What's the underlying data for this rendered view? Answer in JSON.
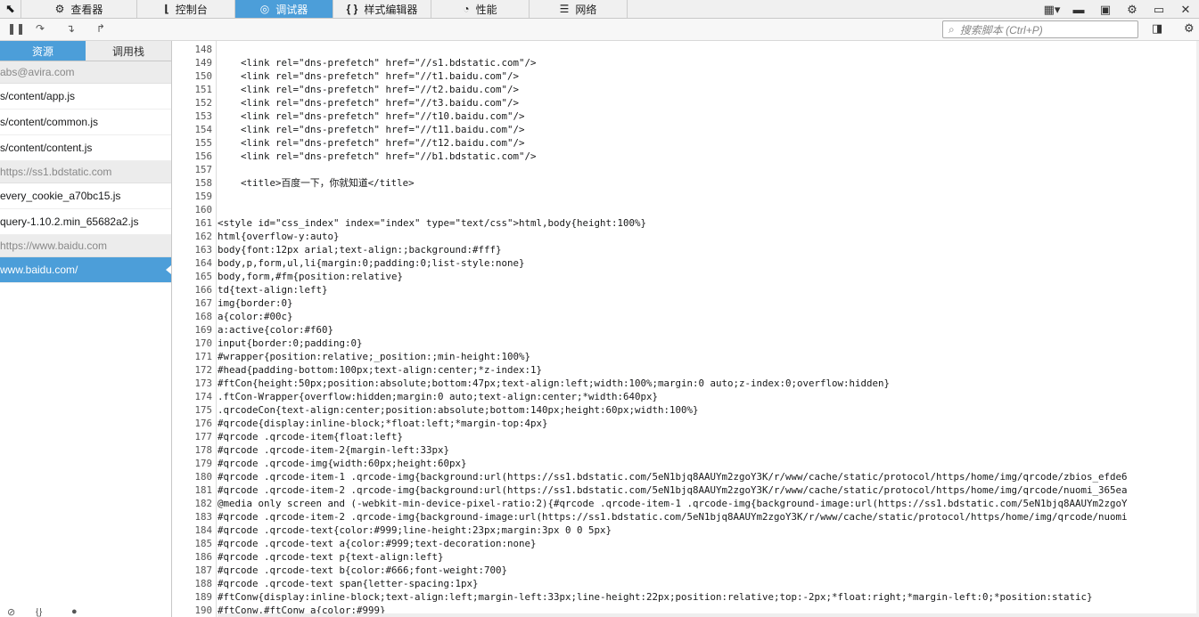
{
  "toolbar": {
    "tabs": [
      {
        "label": "查看器",
        "icon": "inspector-icon"
      },
      {
        "label": "控制台",
        "icon": "console-icon"
      },
      {
        "label": "调试器",
        "icon": "debugger-icon"
      },
      {
        "label": "样式编辑器",
        "icon": "style-editor-icon"
      },
      {
        "label": "性能",
        "icon": "performance-icon"
      },
      {
        "label": "网络",
        "icon": "network-icon"
      }
    ],
    "active_tab": "调试器",
    "accent": "#4c9ed9"
  },
  "search": {
    "placeholder": "搜索脚本 (Ctrl+P)"
  },
  "sidebar": {
    "tabs": [
      "资源",
      "调用栈"
    ],
    "active_tab": "资源",
    "groups": [
      {
        "label": "abs@avira.com",
        "items": [
          "s/content/app.js",
          "s/content/common.js",
          "s/content/content.js"
        ]
      },
      {
        "label": "https://ss1.bdstatic.com",
        "items": [
          "every_cookie_a70bc15.js",
          "query-1.10.2.min_65682a2.js"
        ]
      },
      {
        "label": "https://www.baidu.com",
        "items": [
          "www.baidu.com/"
        ]
      }
    ],
    "selected": "www.baidu.com/"
  },
  "editor": {
    "lines": [
      {
        "n": "148",
        "code": ""
      },
      {
        "n": "149",
        "code": "    <link rel=\"dns-prefetch\" href=\"//s1.bdstatic.com\"/>"
      },
      {
        "n": "150",
        "code": "    <link rel=\"dns-prefetch\" href=\"//t1.baidu.com\"/>"
      },
      {
        "n": "151",
        "code": "    <link rel=\"dns-prefetch\" href=\"//t2.baidu.com\"/>"
      },
      {
        "n": "152",
        "code": "    <link rel=\"dns-prefetch\" href=\"//t3.baidu.com\"/>"
      },
      {
        "n": "153",
        "code": "    <link rel=\"dns-prefetch\" href=\"//t10.baidu.com\"/>"
      },
      {
        "n": "154",
        "code": "    <link rel=\"dns-prefetch\" href=\"//t11.baidu.com\"/>"
      },
      {
        "n": "155",
        "code": "    <link rel=\"dns-prefetch\" href=\"//t12.baidu.com\"/>"
      },
      {
        "n": "156",
        "code": "    <link rel=\"dns-prefetch\" href=\"//b1.bdstatic.com\"/>"
      },
      {
        "n": "157",
        "code": ""
      },
      {
        "n": "158",
        "code": "    <title>百度一下，你就知道</title>"
      },
      {
        "n": "159",
        "code": ""
      },
      {
        "n": "160",
        "code": ""
      },
      {
        "n": "161",
        "code": "<style id=\"css_index\" index=\"index\" type=\"text/css\">html,body{height:100%}"
      },
      {
        "n": "162",
        "code": "html{overflow-y:auto}"
      },
      {
        "n": "163",
        "code": "body{font:12px arial;text-align:;background:#fff}"
      },
      {
        "n": "164",
        "code": "body,p,form,ul,li{margin:0;padding:0;list-style:none}"
      },
      {
        "n": "165",
        "code": "body,form,#fm{position:relative}"
      },
      {
        "n": "166",
        "code": "td{text-align:left}"
      },
      {
        "n": "167",
        "code": "img{border:0}"
      },
      {
        "n": "168",
        "code": "a{color:#00c}"
      },
      {
        "n": "169",
        "code": "a:active{color:#f60}"
      },
      {
        "n": "170",
        "code": "input{border:0;padding:0}"
      },
      {
        "n": "171",
        "code": "#wrapper{position:relative;_position:;min-height:100%}"
      },
      {
        "n": "172",
        "code": "#head{padding-bottom:100px;text-align:center;*z-index:1}"
      },
      {
        "n": "173",
        "code": "#ftCon{height:50px;position:absolute;bottom:47px;text-align:left;width:100%;margin:0 auto;z-index:0;overflow:hidden}"
      },
      {
        "n": "174",
        "code": ".ftCon-Wrapper{overflow:hidden;margin:0 auto;text-align:center;*width:640px}"
      },
      {
        "n": "175",
        "code": ".qrcodeCon{text-align:center;position:absolute;bottom:140px;height:60px;width:100%}"
      },
      {
        "n": "176",
        "code": "#qrcode{display:inline-block;*float:left;*margin-top:4px}"
      },
      {
        "n": "177",
        "code": "#qrcode .qrcode-item{float:left}"
      },
      {
        "n": "178",
        "code": "#qrcode .qrcode-item-2{margin-left:33px}"
      },
      {
        "n": "179",
        "code": "#qrcode .qrcode-img{width:60px;height:60px}"
      },
      {
        "n": "180",
        "code": "#qrcode .qrcode-item-1 .qrcode-img{background:url(https://ss1.bdstatic.com/5eN1bjq8AAUYm2zgoY3K/r/www/cache/static/protocol/https/home/img/qrcode/zbios_efde6"
      },
      {
        "n": "181",
        "code": "#qrcode .qrcode-item-2 .qrcode-img{background:url(https://ss1.bdstatic.com/5eN1bjq8AAUYm2zgoY3K/r/www/cache/static/protocol/https/home/img/qrcode/nuomi_365ea"
      },
      {
        "n": "182",
        "code": "@media only screen and (-webkit-min-device-pixel-ratio:2){#qrcode .qrcode-item-1 .qrcode-img{background-image:url(https://ss1.bdstatic.com/5eN1bjq8AAUYm2zgoY"
      },
      {
        "n": "183",
        "code": "#qrcode .qrcode-item-2 .qrcode-img{background-image:url(https://ss1.bdstatic.com/5eN1bjq8AAUYm2zgoY3K/r/www/cache/static/protocol/https/home/img/qrcode/nuomi"
      },
      {
        "n": "184",
        "code": "#qrcode .qrcode-text{color:#999;line-height:23px;margin:3px 0 0 5px}"
      },
      {
        "n": "185",
        "code": "#qrcode .qrcode-text a{color:#999;text-decoration:none}"
      },
      {
        "n": "186",
        "code": "#qrcode .qrcode-text p{text-align:left}"
      },
      {
        "n": "187",
        "code": "#qrcode .qrcode-text b{color:#666;font-weight:700}"
      },
      {
        "n": "188",
        "code": "#qrcode .qrcode-text span{letter-spacing:1px}"
      },
      {
        "n": "189",
        "code": "#ftConw{display:inline-block;text-align:left;margin-left:33px;line-height:22px;position:relative;top:-2px;*float:right;*margin-left:0;*position:static}"
      },
      {
        "n": "190",
        "code": "#ftConw,#ftConw a{color:#999}"
      }
    ]
  }
}
